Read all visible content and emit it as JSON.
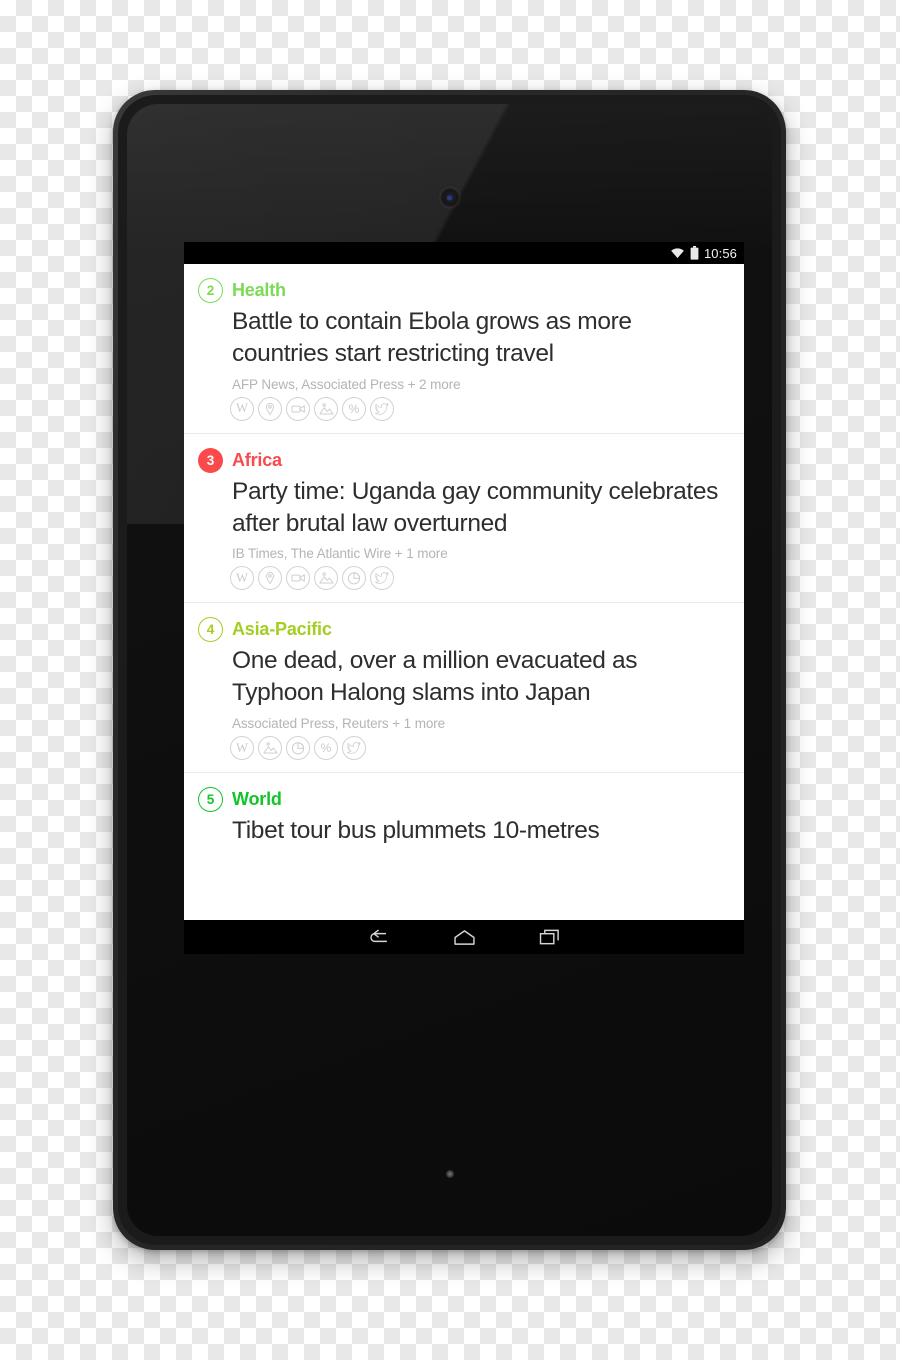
{
  "device": {
    "type": "android-tablet",
    "frame_color": "#2b2b2b"
  },
  "statusbar": {
    "wifi_icon": "wifi-icon",
    "battery_icon": "battery-icon",
    "time": "10:56"
  },
  "feed": {
    "items": [
      {
        "rank": "2",
        "category": "Health",
        "category_color": "#7ed957",
        "badge_style": "outline",
        "headline": "Battle to contain Ebola grows as more countries start restricting travel",
        "sources": "AFP News, Associated Press + 2 more",
        "icons": [
          "wikipedia-icon",
          "location-pin-icon",
          "video-camera-icon",
          "image-icon",
          "percent-icon",
          "twitter-icon"
        ]
      },
      {
        "rank": "3",
        "category": "Africa",
        "category_color": "#fb4a4c",
        "badge_style": "filled",
        "headline": "Party time: Uganda gay community celebrates after brutal law overturned",
        "sources": "IB Times, The Atlantic Wire + 1 more",
        "icons": [
          "wikipedia-icon",
          "location-pin-icon",
          "video-camera-icon",
          "image-icon",
          "pie-chart-icon",
          "twitter-icon"
        ]
      },
      {
        "rank": "4",
        "category": "Asia-Pacific",
        "category_color": "#a4ce22",
        "badge_style": "outline",
        "headline": "One dead, over a million evacuated as Typhoon Halong slams into Japan",
        "sources": "Associated Press, Reuters + 1 more",
        "icons": [
          "wikipedia-icon",
          "image-icon",
          "pie-chart-icon",
          "percent-icon",
          "twitter-icon"
        ]
      },
      {
        "rank": "5",
        "category": "World",
        "category_color": "#12c42a",
        "badge_style": "outline",
        "headline": "Tibet tour bus plummets 10-metres",
        "sources": "",
        "icons": []
      }
    ]
  },
  "navbar": {
    "back_label": "back-icon",
    "home_label": "home-icon",
    "recents_label": "recent-apps-icon"
  }
}
